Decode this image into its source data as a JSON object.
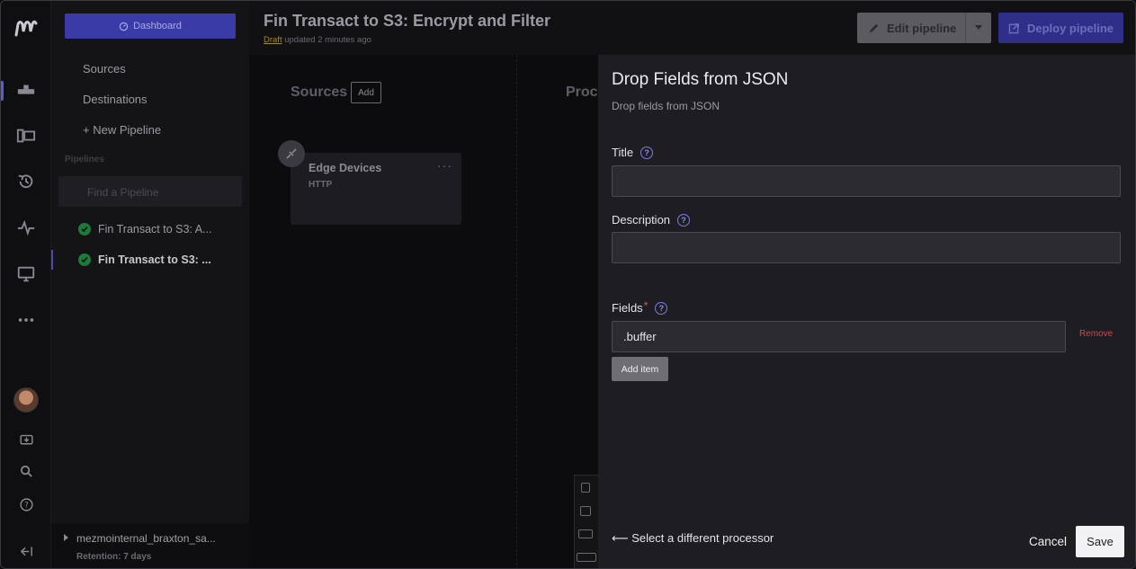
{
  "nav": {
    "dashboard_label": "Dashboard",
    "sources": "Sources",
    "destinations": "Destinations",
    "new_pipeline": "+  New Pipeline",
    "pipelines_heading": "Pipelines",
    "search_placeholder": "Find a Pipeline",
    "pipelines": [
      {
        "label": "Fin Transact to S3: A...",
        "status": "success"
      },
      {
        "label": "Fin Transact to S3: ...",
        "status": "success"
      }
    ],
    "org_name": "mezmointernal_braxton_sa...",
    "retention": "Retention: 7 days"
  },
  "header": {
    "title": "Fin Transact to S3: Encrypt and Filter",
    "draft": "Draft",
    "updated": " updated 2 minutes ago",
    "edit_label": "Edit pipeline",
    "deploy_label": "Deploy pipeline"
  },
  "canvas": {
    "sources_title": "Sources",
    "add_label": "Add",
    "processors_title": "Proc",
    "node": {
      "title": "Edge Devices",
      "subtitle": "HTTP"
    }
  },
  "panel": {
    "title": "Drop Fields from JSON",
    "description": "Drop fields from JSON",
    "title_label": "Title",
    "title_value": "",
    "description_label": "Description",
    "description_value": "",
    "fields_label": "Fields",
    "fields_required": "*",
    "field_value": ".buffer",
    "remove_label": "Remove",
    "add_item_label": "Add item",
    "back_label": "⟵ Select a different processor",
    "cancel_label": "Cancel",
    "save_label": "Save"
  },
  "colors": {
    "accent": "#3b3ba8",
    "help": "#7a7ae6",
    "danger": "#d04848",
    "success": "#1d7a3a"
  }
}
